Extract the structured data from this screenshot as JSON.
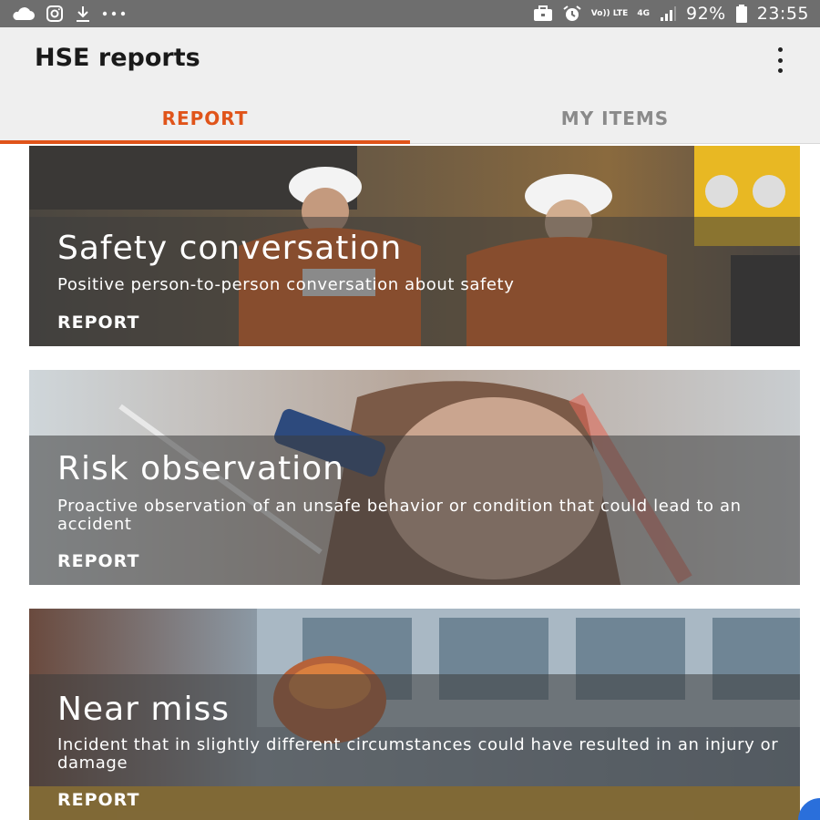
{
  "status_bar": {
    "battery_pct": "92%",
    "time": "23:55",
    "volte": "Vo)) LTE",
    "network": "4G",
    "icons_left": [
      "cloud-icon",
      "instagram-icon",
      "download-icon",
      "more-horiz-icon"
    ],
    "icons_right": [
      "briefcase-icon",
      "alarm-icon",
      "volte-icon",
      "network-4g-icon",
      "signal-icon",
      "battery-icon"
    ]
  },
  "app_bar": {
    "title": "HSE reports",
    "menu_icon": "more-vert-icon"
  },
  "tabs": [
    {
      "label": "REPORT",
      "active": true
    },
    {
      "label": "MY ITEMS",
      "active": false
    }
  ],
  "cards": [
    {
      "title": "Safety conversation",
      "description": "Positive person-to-person conversation about safety",
      "action": "REPORT"
    },
    {
      "title": "Risk observation",
      "description": "Proactive observation of an unsafe behavior or  condition that could lead to an accident",
      "action": "REPORT"
    },
    {
      "title": "Near miss",
      "description": "Incident that in slightly different circumstances could have resulted in an injury or damage",
      "action": "REPORT"
    }
  ],
  "colors": {
    "accent": "#e0541a",
    "status_bar": "#6e6e6e",
    "app_bar": "#efefef"
  }
}
